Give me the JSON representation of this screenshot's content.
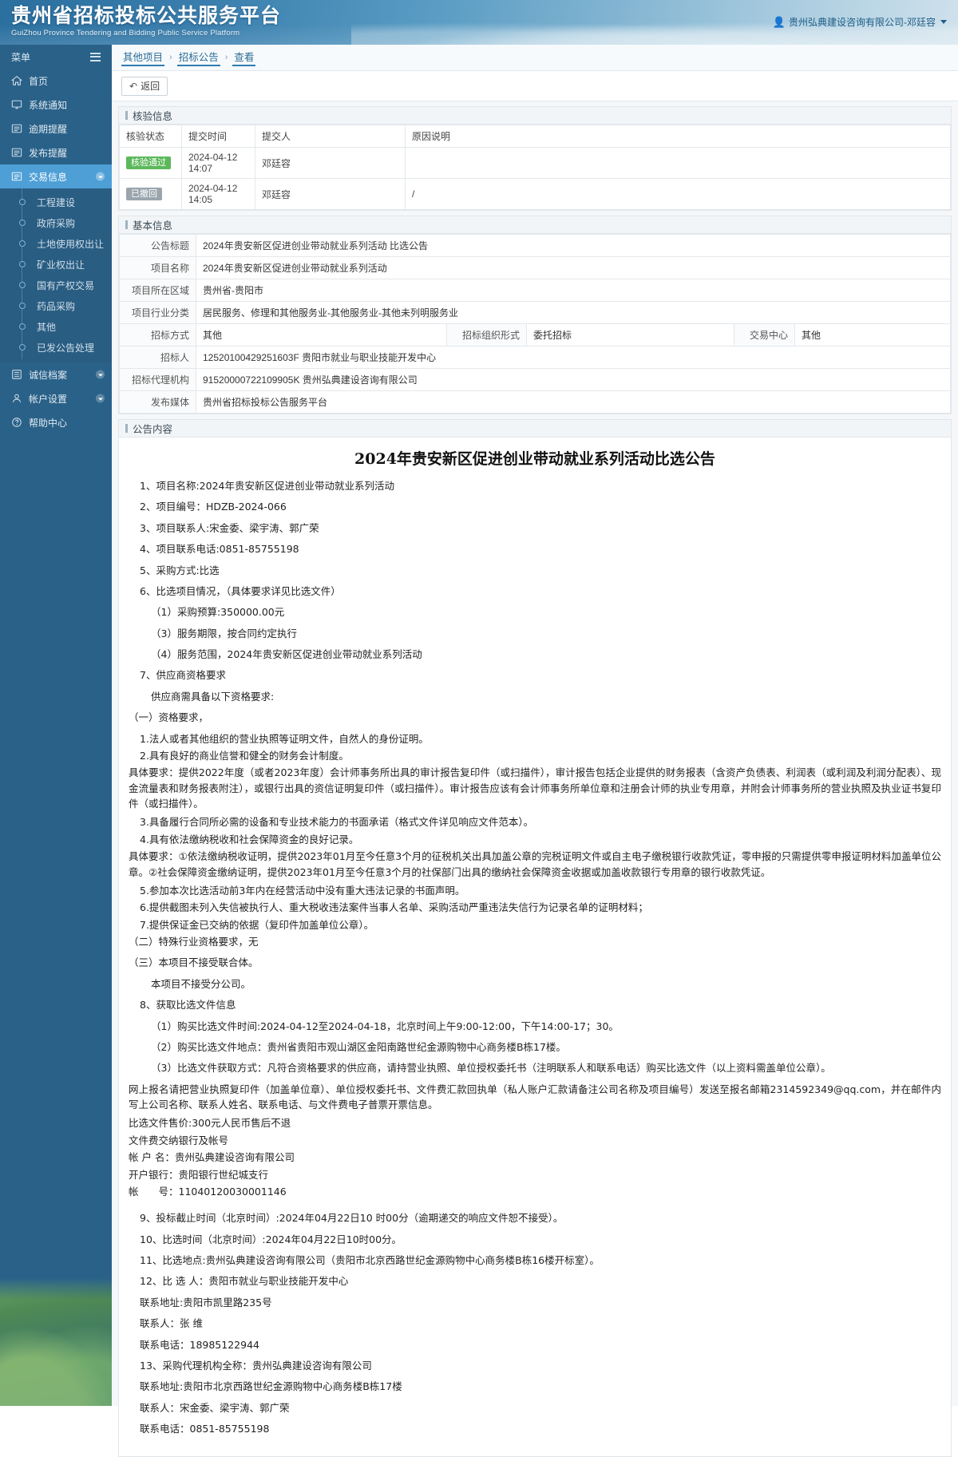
{
  "header": {
    "title_cn": "贵州省招标投标公共服务平台",
    "title_en": "GuiZhou Province Tendering and Bidding Public Service Platform",
    "user": "贵州弘典建设咨询有限公司-邓廷容",
    "user_icon": "user-icon"
  },
  "sidebar": {
    "menu_label": "菜单",
    "items": [
      {
        "label": "首页",
        "icon": "home-icon",
        "active": false,
        "expandable": false
      },
      {
        "label": "系统通知",
        "icon": "monitor-icon",
        "active": false,
        "expandable": false
      },
      {
        "label": "逾期提醒",
        "icon": "list-icon",
        "active": false,
        "expandable": false
      },
      {
        "label": "发布提醒",
        "icon": "list-icon",
        "active": false,
        "expandable": false
      },
      {
        "label": "交易信息",
        "icon": "list-icon",
        "active": true,
        "expandable": true
      }
    ],
    "submenu": [
      "工程建设",
      "政府采购",
      "土地使用权出让",
      "矿业权出让",
      "国有产权交易",
      "药品采购",
      "其他",
      "已发公告处理"
    ],
    "items_bottom": [
      {
        "label": "诚信档案",
        "icon": "archive-icon",
        "expandable": true
      },
      {
        "label": "帐户设置",
        "icon": "user-settings-icon",
        "expandable": true
      },
      {
        "label": "帮助中心",
        "icon": "help-icon",
        "expandable": false
      }
    ]
  },
  "breadcrumb": {
    "items": [
      "其他项目",
      "招标公告",
      "查看"
    ],
    "sep": "›"
  },
  "toolbar": {
    "back_label": "返回",
    "back_icon": "undo-icon"
  },
  "verify_panel": {
    "title": "核验信息",
    "columns": [
      "核验状态",
      "提交时间",
      "提交人",
      "原因说明"
    ],
    "rows": [
      {
        "status": "核验通过",
        "status_color": "#5cb85c",
        "time": "2024-04-12 14:07",
        "person": "邓廷容",
        "reason": ""
      },
      {
        "status": "已撤回",
        "status_color": "#9aa5ad",
        "time": "2024-04-12 14:05",
        "person": "邓廷容",
        "reason": "/"
      }
    ]
  },
  "basic_panel": {
    "title": "基本信息",
    "rows": [
      {
        "k": "公告标题",
        "v": "2024年贵安新区促进创业带动就业系列活动 比选公告"
      },
      {
        "k": "项目名称",
        "v": "2024年贵安新区促进创业带动就业系列活动"
      },
      {
        "k": "项目所在区域",
        "v": "贵州省-贵阳市"
      },
      {
        "k": "项目行业分类",
        "v": "居民服务、修理和其他服务业-其他服务业-其他未列明服务业"
      }
    ],
    "triple_row": [
      {
        "k": "招标方式",
        "v": "其他"
      },
      {
        "k": "招标组织形式",
        "v": "委托招标"
      },
      {
        "k": "交易中心",
        "v": "其他"
      }
    ],
    "rows2": [
      {
        "k": "招标人",
        "v": "12520100429251603F 贵阳市就业与职业技能开发中心"
      },
      {
        "k": "招标代理机构",
        "v": "91520000722109905K 贵州弘典建设咨询有限公司"
      },
      {
        "k": "发布媒体",
        "v": "贵州省招标投标公告服务平台"
      }
    ]
  },
  "content_panel": {
    "title": "公告内容",
    "doc_title": "2024年贵安新区促进创业带动就业系列活动比选公告",
    "lines": [
      {
        "t": "1、项目名称:2024年贵安新区促进创业带动就业系列活动",
        "s": "i1"
      },
      {
        "t": "2、项目编号：HDZB-2024-066",
        "s": "i1"
      },
      {
        "t": "3、项目联系人:宋金委、梁宇涛、郭广荣",
        "s": "i1"
      },
      {
        "t": "4、项目联系电话:0851-85755198",
        "s": "i1"
      },
      {
        "t": "5、采购方式:比选",
        "s": "i1"
      },
      {
        "t": "6、比选项目情况，（具体要求详见比选文件）",
        "s": "i1"
      },
      {
        "t": "（1）采购预算:350000.00元",
        "s": "i2"
      },
      {
        "t": "（3）服务期限，按合同约定执行",
        "s": "i2"
      },
      {
        "t": "（4）服务范围，2024年贵安新区促进创业带动就业系列活动",
        "s": "i2"
      },
      {
        "t": "7、供应商资格要求",
        "s": "i1"
      },
      {
        "t": "供应商需具备以下资格要求:",
        "s": "i2"
      },
      {
        "t": "（一）资格要求，",
        "s": ""
      },
      {
        "t": "1.法人或者其他组织的营业执照等证明文件，自然人的身份证明。",
        "s": "i1 tight"
      },
      {
        "t": "2.具有良好的商业信誉和健全的财务会计制度。",
        "s": "i1 tight"
      },
      {
        "t": "具体要求：提供2022年度（或者2023年度）会计师事务所出具的审计报告复印件（或扫描件），审计报告包括企业提供的财务报表（含资产负债表、利润表（或利润及利润分配表）、现金流量表和财务报表附注），或银行出具的资信证明复印件（或扫描件）。审计报告应该有会计师事务所单位章和注册会计师的执业专用章，并附会计师事务所的营业执照及执业证书复印件（或扫描件）。",
        "s": "flow"
      },
      {
        "t": "3.具备履行合同所必需的设备和专业技术能力的书面承诺（格式文件详见响应文件范本）。",
        "s": "i1 tight"
      },
      {
        "t": "4.具有依法缴纳税收和社会保障资金的良好记录。",
        "s": "i1 tight"
      },
      {
        "t": "具体要求：①依法缴纳税收证明，提供2023年01月至今任意3个月的征税机关出具加盖公章的完税证明文件或自主电子缴税银行收款凭证，零申报的只需提供零申报证明材料加盖单位公章。②社会保障资金缴纳证明，提供2023年01月至今任意3个月的社保部门出具的缴纳社会保障资金收据或加盖收款银行专用章的银行收款凭证。",
        "s": "flow"
      },
      {
        "t": "5.参加本次比选活动前3年内在经营活动中没有重大违法记录的书面声明。",
        "s": "i1 tight"
      },
      {
        "t": "6.提供截图未列入失信被执行人、重大税收违法案件当事人名单、采购活动严重违法失信行为记录名单的证明材料；",
        "s": "i1 tight"
      },
      {
        "t": "7.提供保证金已交纳的依据（复印件加盖单位公章）。",
        "s": "i1 tight"
      },
      {
        "t": "（二）特殊行业资格要求，无",
        "s": ""
      },
      {
        "t": "（三）本项目不接受联合体。",
        "s": ""
      },
      {
        "t": "本项目不接受分公司。",
        "s": "i2"
      },
      {
        "t": "8、获取比选文件信息",
        "s": "i1"
      },
      {
        "t": "（1）购买比选文件时间:2024-04-12至2024-04-18，北京时间上午9:00-12:00，下午14:00-17；30。",
        "s": "i2"
      },
      {
        "t": "（2）购买比选文件地点：贵州省贵阳市观山湖区金阳南路世纪金源购物中心商务楼B栋17楼。",
        "s": "i2"
      },
      {
        "t": "（3）比选文件获取方式：凡符合资格要求的供应商，请持营业执照、单位授权委托书（注明联系人和联系电话）购买比选文件（以上资料需盖单位公章）。",
        "s": "i2"
      },
      {
        "t": "网上报名请把营业执照复印件（加盖单位章）、单位授权委托书、文件费汇款回执单（私人账户汇款请备注公司名称及项目编号）发送至报名邮箱2314592349@qq.com，并在邮件内写上公司名称、联系人姓名、联系电话、与文件费电子普票开票信息。",
        "s": "flow"
      },
      {
        "t": "比选文件售价:300元人民币售后不退",
        "s": "tight"
      },
      {
        "t": "文件费交纳银行及帐号",
        "s": "tight"
      },
      {
        "t": "帐 户 名：贵州弘典建设咨询有限公司",
        "s": "tight"
      },
      {
        "t": "开户银行：贵阳银行世纪城支行",
        "s": "tight"
      },
      {
        "t": "帐　　号：11040120030001146",
        "s": "tight"
      },
      {
        "t": "",
        "s": "gapline"
      },
      {
        "t": "9、投标截止时间（北京时间）:2024年04月22日10 时00分（逾期递交的响应文件恕不接受）。",
        "s": "i1"
      },
      {
        "t": "10、比选时间（北京时间）:2024年04月22日10时00分。",
        "s": "i1"
      },
      {
        "t": "11、比选地点:贵州弘典建设咨询有限公司（贵阳市北京西路世纪金源购物中心商务楼B栋16楼开标室）。",
        "s": "i1"
      },
      {
        "t": "12、比 选 人：贵阳市就业与职业技能开发中心",
        "s": "i1"
      },
      {
        "t": "联系地址:贵阳市凯里路235号",
        "s": "i1"
      },
      {
        "t": "联系人：张 维",
        "s": "i1"
      },
      {
        "t": "联系电话：18985122944",
        "s": "i1"
      },
      {
        "t": "13、采购代理机构全称：贵州弘典建设咨询有限公司",
        "s": "i1"
      },
      {
        "t": "联系地址:贵阳市北京西路世纪金源购物中心商务楼B栋17楼",
        "s": "i1"
      },
      {
        "t": "联系人：宋金委、梁宇涛、郭广荣",
        "s": "i1"
      },
      {
        "t": "联系电话：0851-85755198",
        "s": "i1"
      }
    ]
  }
}
